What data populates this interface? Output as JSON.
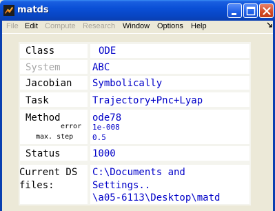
{
  "window": {
    "title": "matds",
    "controls": {
      "minimize": "minimize",
      "maximize": "maximize",
      "close": "close"
    }
  },
  "menu": {
    "items": [
      {
        "label": "File",
        "enabled": false
      },
      {
        "label": "Edit",
        "enabled": true
      },
      {
        "label": "Compute",
        "enabled": false
      },
      {
        "label": "Research",
        "enabled": false
      },
      {
        "label": "Window",
        "enabled": true
      },
      {
        "label": "Options",
        "enabled": true
      },
      {
        "label": "Help",
        "enabled": true
      }
    ]
  },
  "panel": {
    "class": {
      "label": "Class",
      "value": "ODE"
    },
    "system": {
      "label": "System",
      "value": "ABC"
    },
    "jacobian": {
      "label": "Jacobian",
      "value": "Symbolically"
    },
    "task": {
      "label": "Task",
      "value": "Trajectory+Pnc+Lyap"
    },
    "method": {
      "label": "Method",
      "value": "ode78",
      "error_label": "error",
      "error_value": "1e-008",
      "maxstep_label": "max. step",
      "maxstep_value": "0.5"
    },
    "status": {
      "label": "Status",
      "value": "1000"
    },
    "files": {
      "label_line1": "Current DS",
      "label_line2": "files:",
      "value_lines": [
        "C:\\Documents and",
        "Settings..",
        "\\a05-6113\\Desktop\\matd"
      ]
    }
  },
  "colors": {
    "title_bar": "#0a4fd6",
    "value_text": "#0000c8",
    "disabled_text": "#a8a49a",
    "window_bg": "#ece9d8"
  }
}
